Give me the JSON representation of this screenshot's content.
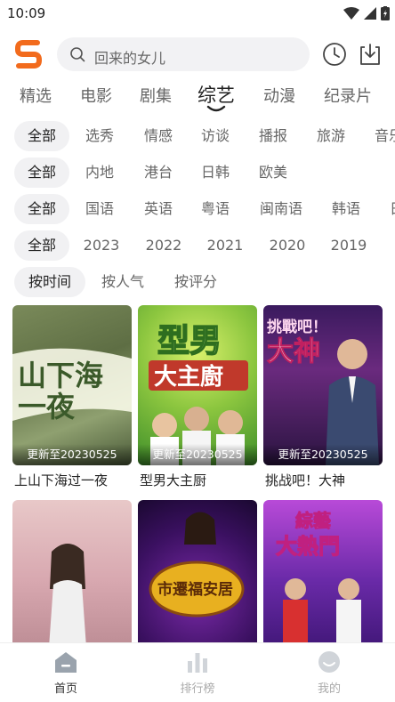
{
  "status_bar": {
    "time": "10:09"
  },
  "search": {
    "placeholder": "回来的女儿"
  },
  "tabs": [
    "精选",
    "电影",
    "剧集",
    "综艺",
    "动漫",
    "纪录片"
  ],
  "active_tab": "综艺",
  "filters": {
    "genre": [
      "全部",
      "选秀",
      "情感",
      "访谈",
      "播报",
      "旅游",
      "音乐"
    ],
    "region": [
      "全部",
      "内地",
      "港台",
      "日韩",
      "欧美"
    ],
    "language": [
      "全部",
      "国语",
      "英语",
      "粤语",
      "闽南语",
      "韩语",
      "日语"
    ],
    "year": [
      "全部",
      "2023",
      "2022",
      "2021",
      "2020",
      "2019"
    ],
    "sort": [
      "按时间",
      "按人气",
      "按评分"
    ]
  },
  "cards": [
    {
      "title": "上山下海过一夜",
      "badge": "更新至20230525",
      "poster_text": "山下海 一夜"
    },
    {
      "title": "型男大主厨",
      "badge": "更新至20230525",
      "poster_text": "型男 大主廚"
    },
    {
      "title": "挑战吧！大神",
      "badge": "更新至20230525",
      "poster_text": "挑戰吧！大神"
    },
    {
      "title": "",
      "badge": "",
      "poster_text": ""
    },
    {
      "title": "",
      "badge": "",
      "poster_text": "市遷福安居"
    },
    {
      "title": "",
      "badge": "",
      "poster_text": "綜藝大熱門"
    }
  ],
  "bottom_nav": [
    {
      "label": "首页",
      "icon": "home-icon",
      "active": true
    },
    {
      "label": "排行榜",
      "icon": "ranking-icon",
      "active": false
    },
    {
      "label": "我的",
      "icon": "profile-icon",
      "active": false
    }
  ],
  "colors": {
    "brand_orange": "#f26b1d",
    "chip_bg": "#f1f1f3",
    "search_bg": "#f2f2f4"
  }
}
